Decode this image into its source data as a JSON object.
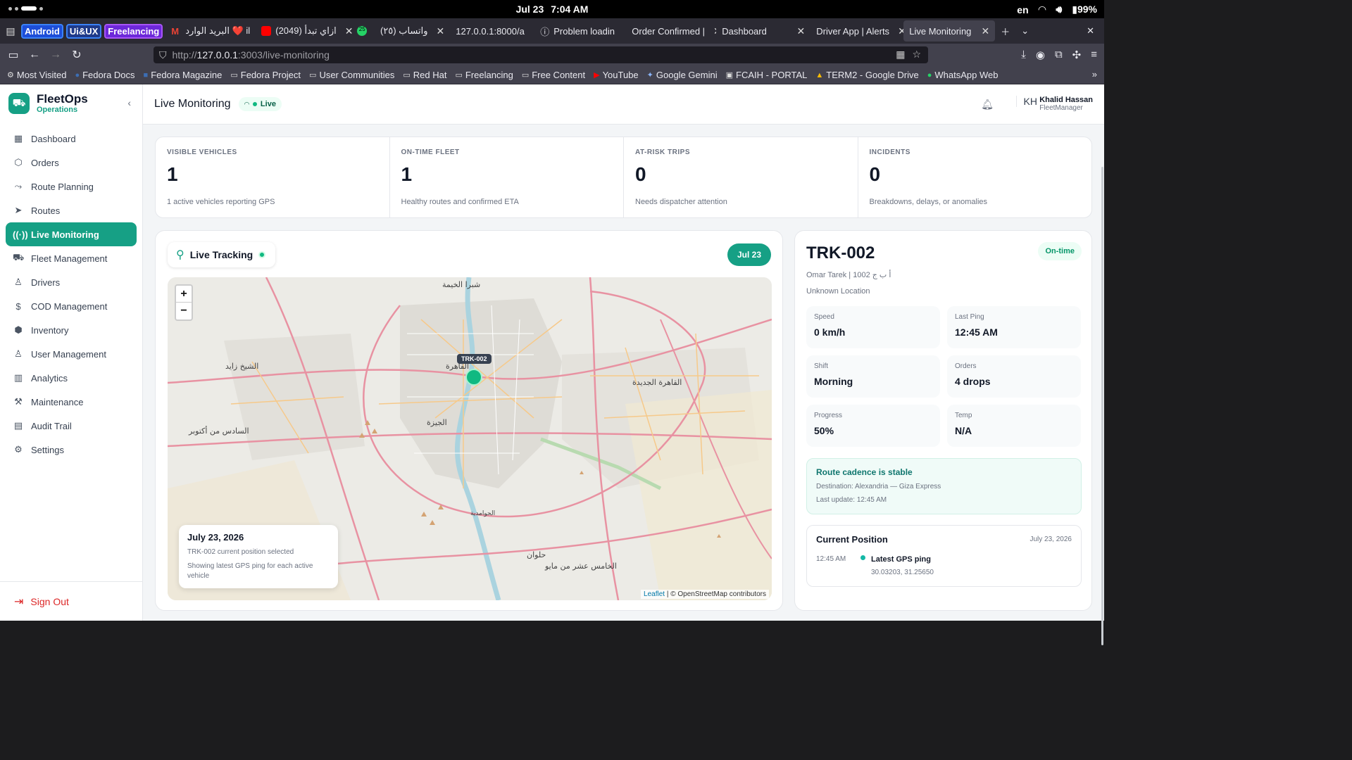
{
  "os": {
    "date": "Jul 23",
    "time": "7:04 AM",
    "lang": "en",
    "battery": "99%"
  },
  "browser": {
    "tab_groups": [
      "Android",
      "Ui&UX",
      "Freelancing"
    ],
    "tabs": [
      {
        "label": "البريد الوارد ❤️ il",
        "icon": "gmail-icon"
      },
      {
        "label": "(2049) ازاي تبدأ",
        "icon": "youtube-icon"
      },
      {
        "label": "25",
        "icon": "whatsapp-badge-icon"
      },
      {
        "label": "(٢٥) واتساب",
        "icon": "whatsapp-icon"
      },
      {
        "label": "127.0.0.1:8000/a",
        "icon": "page-icon"
      },
      {
        "label": "Problem loadin",
        "icon": "info-icon"
      },
      {
        "label": "Order Confirmed |",
        "icon": "page-icon"
      },
      {
        "label": "Dashboard",
        "icon": "page-icon"
      },
      {
        "label": "Driver App | Alerts",
        "icon": "page-icon"
      },
      {
        "label": "Live Monitoring",
        "icon": "page-icon"
      }
    ],
    "url_prefix": "http://",
    "url_host": "127.0.0.1",
    "url_rest": ":3003/live-monitoring",
    "bookmarks": [
      "Most Visited",
      "Fedora Docs",
      "Fedora Magazine",
      "Fedora Project",
      "User Communities",
      "Red Hat",
      "Freelancing",
      "Free Content",
      "YouTube",
      "Google Gemini",
      "FCAIH - PORTAL",
      "TERM2 - Google Drive",
      "WhatsApp Web"
    ]
  },
  "app": {
    "brand_title": "FleetOps",
    "brand_subtitle": "Operations",
    "accent": "#16a085",
    "nav": [
      {
        "label": "Dashboard",
        "icon": "grid-icon"
      },
      {
        "label": "Orders",
        "icon": "box-icon"
      },
      {
        "label": "Route Planning",
        "icon": "route-icon"
      },
      {
        "label": "Routes",
        "icon": "navigation-icon"
      },
      {
        "label": "Live Monitoring",
        "icon": "radio-icon",
        "active": true
      },
      {
        "label": "Fleet Management",
        "icon": "truck-icon"
      },
      {
        "label": "Drivers",
        "icon": "user-icon"
      },
      {
        "label": "COD Management",
        "icon": "dollar-icon"
      },
      {
        "label": "Inventory",
        "icon": "boxes-icon"
      },
      {
        "label": "User Management",
        "icon": "users-icon"
      },
      {
        "label": "Analytics",
        "icon": "chart-icon"
      },
      {
        "label": "Maintenance",
        "icon": "wrench-icon"
      },
      {
        "label": "Audit Trail",
        "icon": "clipboard-icon"
      },
      {
        "label": "Settings",
        "icon": "gear-icon"
      }
    ],
    "sign_out": "Sign Out"
  },
  "header": {
    "title": "Live Monitoring",
    "live_badge": "Live",
    "user_initials": "KH",
    "user_name": "Khalid Hassan",
    "user_role": "FleetManager"
  },
  "stats": [
    {
      "label": "VISIBLE VEHICLES",
      "value": "1",
      "sub": "1 active vehicles reporting GPS"
    },
    {
      "label": "ON-TIME FLEET",
      "value": "1",
      "sub": "Healthy routes and confirmed ETA"
    },
    {
      "label": "AT-RISK TRIPS",
      "value": "0",
      "sub": "Needs dispatcher attention"
    },
    {
      "label": "INCIDENTS",
      "value": "0",
      "sub": "Breakdowns, delays, or anomalies"
    }
  ],
  "tracking": {
    "title": "Live Tracking",
    "date_pill": "Jul 23",
    "marker_label": "TRK-002",
    "info_date": "July 23, 2026",
    "info_line1": "TRK-002 current position selected",
    "info_line2": "Showing latest GPS ping for each active vehicle",
    "attribution_link": "Leaflet",
    "attribution_text": " | © OpenStreetMap contributors",
    "map_places": [
      "شبرا الخيمة",
      "القاهرة",
      "الجيزة",
      "الشيخ زايد",
      "السادس من أكتوبر",
      "القاهرة الجديدة",
      "حلوان",
      "الخامس عشر من مايو",
      "الحوامدية"
    ]
  },
  "vehicle": {
    "id": "TRK-002",
    "status": "On-time",
    "driver_plate": "Omar Tarek | 1002 أ ب ج",
    "location": "Unknown Location",
    "metrics": [
      {
        "label": "Speed",
        "value": "0 km/h"
      },
      {
        "label": "Last Ping",
        "value": "12:45 AM"
      },
      {
        "label": "Shift",
        "value": "Morning"
      },
      {
        "label": "Orders",
        "value": "4 drops"
      },
      {
        "label": "Progress",
        "value": "50%"
      },
      {
        "label": "Temp",
        "value": "N/A"
      }
    ],
    "cadence_title": "Route cadence is stable",
    "cadence_dest": "Destination: Alexandria — Giza Express",
    "cadence_update": "Last update: 12:45 AM",
    "position_title": "Current Position",
    "position_date": "July 23, 2026",
    "position_time": "12:45 AM",
    "position_event": "Latest GPS ping",
    "position_coords": "30.03203, 31.25650"
  }
}
